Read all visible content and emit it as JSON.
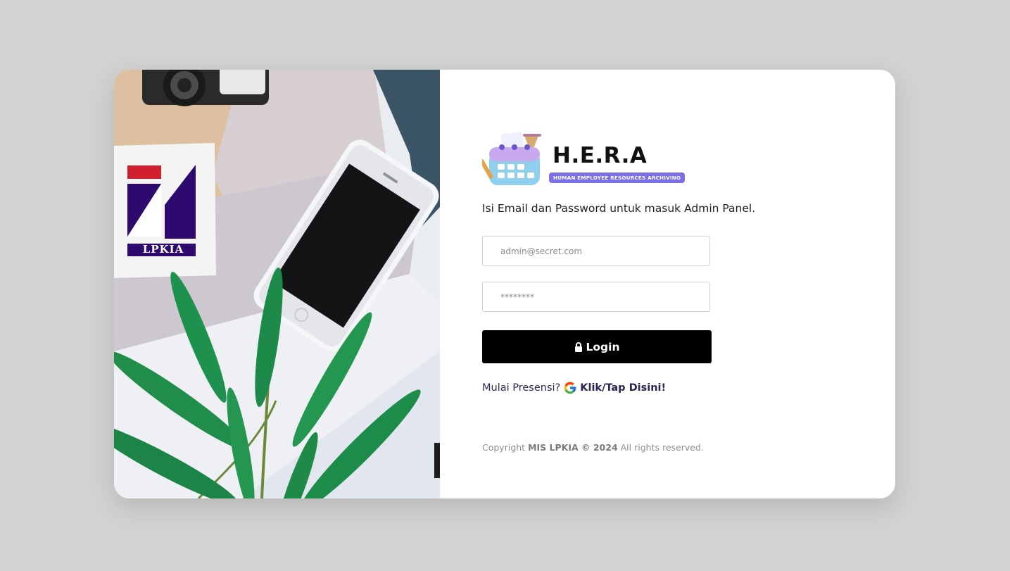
{
  "brand": {
    "name": "H.E.R.A",
    "tagline": "HUMAN EMPLOYEE RESOURCES ARCHIVING",
    "accent": "#7b6fe6"
  },
  "side_image": {
    "logo_text": "LPKIA",
    "logo_colors": {
      "red": "#d0202e",
      "purple": "#2e0a6f"
    }
  },
  "login": {
    "instruction": "Isi Email dan Password untuk masuk Admin Panel.",
    "email_placeholder": "admin@secret.com",
    "email_value": "",
    "password_placeholder": "********",
    "password_value": "",
    "button_label": "Login",
    "button_icon": "lock-icon"
  },
  "presensi": {
    "prefix": "Mulai Presensi?",
    "icon": "google-icon",
    "link_label": "Klik/Tap Disini!"
  },
  "footer": {
    "copyright_prefix": "Copyright",
    "copyright_org": "MIS LPKIA © 2024",
    "copyright_suffix": "All rights reserved."
  }
}
